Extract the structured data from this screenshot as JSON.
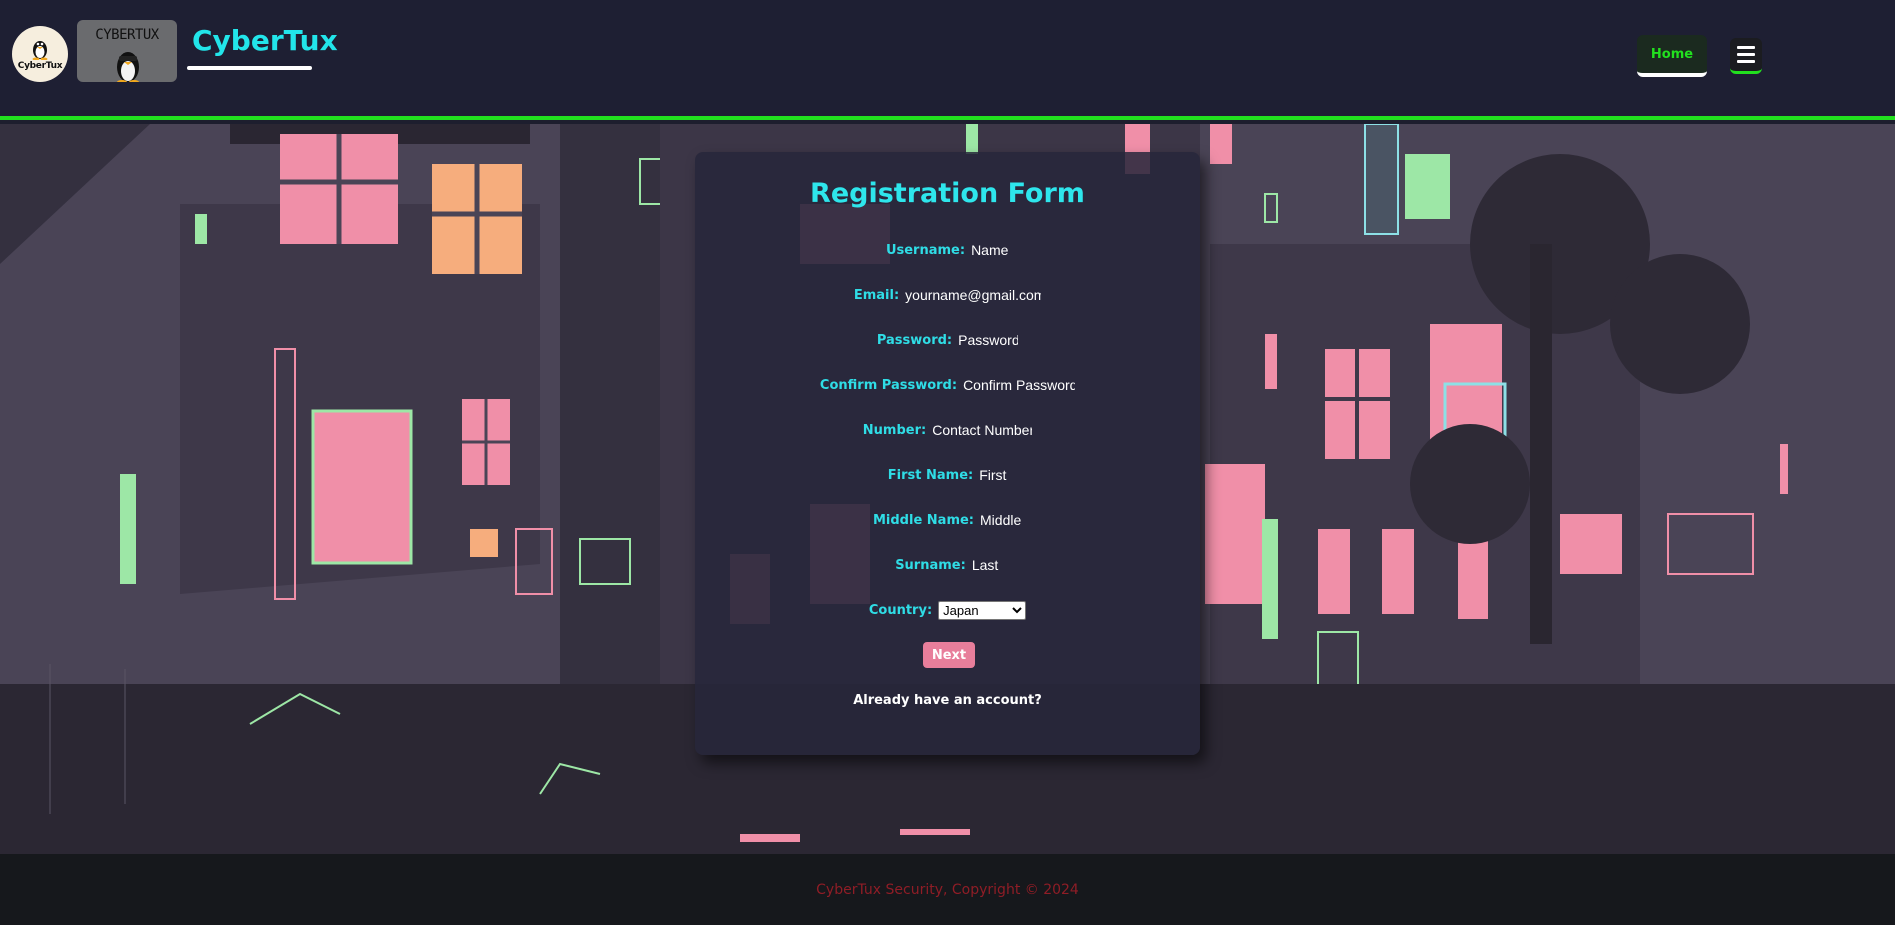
{
  "header": {
    "logo_text": "CyberTux",
    "banner_text": "CYBERTUX",
    "brand_title": "CyberTux",
    "home_label": "Home",
    "menu_icon": "hamburger-icon"
  },
  "form": {
    "title": "Registration Form",
    "fields": [
      {
        "label": "Username:",
        "placeholder": "Name"
      },
      {
        "label": "Email:",
        "placeholder": "yourname@gmail.com"
      },
      {
        "label": "Password:",
        "placeholder": "Password"
      },
      {
        "label": "Confirm Password:",
        "placeholder": "Confirm Password"
      },
      {
        "label": "Number:",
        "placeholder": "Contact Number"
      },
      {
        "label": "First Name:",
        "placeholder": "First"
      },
      {
        "label": "Middle Name:",
        "placeholder": "Middle"
      },
      {
        "label": "Surname:",
        "placeholder": "Last"
      }
    ],
    "country_label": "Country:",
    "country_value": "Japan",
    "next_label": "Next",
    "account_link": "Already have an account?"
  },
  "footer": {
    "text": "CyberTux Security, Copyright © 2024"
  },
  "colors": {
    "accent_green": "#22e01f",
    "title_cyan": "#2ee6ec",
    "next_pink": "#e87e9b",
    "footer_red": "#8f1d26"
  }
}
